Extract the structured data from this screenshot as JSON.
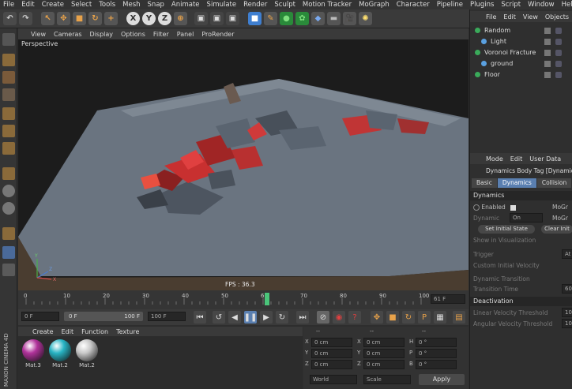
{
  "menubar": [
    "File",
    "Edit",
    "Create",
    "Select",
    "Tools",
    "Mesh",
    "Snap",
    "Animate",
    "Simulate",
    "Render",
    "Sculpt",
    "Motion Tracker",
    "MoGraph",
    "Character",
    "Pipeline",
    "Plugins",
    "Script",
    "Window",
    "Help"
  ],
  "viewport_menu": [
    "View",
    "Cameras",
    "Display",
    "Options",
    "Filter",
    "Panel",
    "ProRender"
  ],
  "viewport": {
    "label": "Perspective",
    "fps": "FPS : 36.3",
    "axis_y": "Y",
    "axis_z": "Z",
    "axis_x": "X"
  },
  "timeline": {
    "ticks": [
      "0",
      "10",
      "20",
      "30",
      "40",
      "50",
      "60",
      "70",
      "80",
      "90",
      "100"
    ],
    "current_frame": "61 F",
    "playhead_fraction": 0.61
  },
  "transport": {
    "start": "0 F",
    "min": "0 F",
    "max": "100 F",
    "end": "100 F"
  },
  "material_menu": [
    "Create",
    "Edit",
    "Function",
    "Texture"
  ],
  "materials": [
    {
      "name": "Mat.3",
      "color": "#b0329a"
    },
    {
      "name": "Mat.2",
      "color": "#28b4c4"
    },
    {
      "name": "Mat.2",
      "color": "#c8c8c8"
    }
  ],
  "brand": "MAXON CINEMA 4D",
  "coords": {
    "headers": [
      "--",
      "--",
      "--"
    ],
    "rows": [
      {
        "a": "X",
        "av": "0 cm",
        "b": "X",
        "bv": "0 cm",
        "c": "H",
        "cv": "0 °"
      },
      {
        "a": "Y",
        "av": "0 cm",
        "b": "Y",
        "bv": "0 cm",
        "c": "P",
        "cv": "0 °"
      },
      {
        "a": "Z",
        "av": "0 cm",
        "b": "Z",
        "bv": "0 cm",
        "c": "B",
        "cv": "0 °"
      }
    ],
    "mode_world": "World",
    "mode_scale": "Scale",
    "apply": "Apply"
  },
  "objects_menu": [
    "File",
    "Edit",
    "View",
    "Objects"
  ],
  "objects": [
    {
      "name": "Random",
      "indent": 0
    },
    {
      "name": "Light",
      "indent": 1
    },
    {
      "name": "Voronoi Fracture",
      "indent": 0
    },
    {
      "name": "ground",
      "indent": 1
    },
    {
      "name": "Floor",
      "indent": 0
    }
  ],
  "attr_menu": [
    "Mode",
    "Edit",
    "User Data"
  ],
  "attr": {
    "title": "Dynamics Body Tag [Dynamics",
    "tabs": [
      "Basic",
      "Dynamics",
      "Collision"
    ],
    "active_tab": "Dynamics",
    "section": "Dynamics",
    "enabled_label": "Enabled",
    "mograph_1": "MoGr",
    "dynamic_label": "Dynamic",
    "dynamic_value": "On",
    "mograph_2": "MoGr",
    "set_initial": "Set Initial State",
    "clear_initial": "Clear Init",
    "show_in_vis": "Show in Visualization",
    "trigger_label": "Trigger",
    "trigger_value": "At",
    "custom_vel": "Custom Initial Velocity",
    "dyn_transition": "Dynamic Transition",
    "trans_time": "Transition Time",
    "trans_value": "60",
    "deactivation": "Deactivation",
    "lin_vel": "Linear Velocity Threshold",
    "lin_val": "10",
    "ang_vel": "Angular Velocity Threshold",
    "ang_val": "10"
  }
}
